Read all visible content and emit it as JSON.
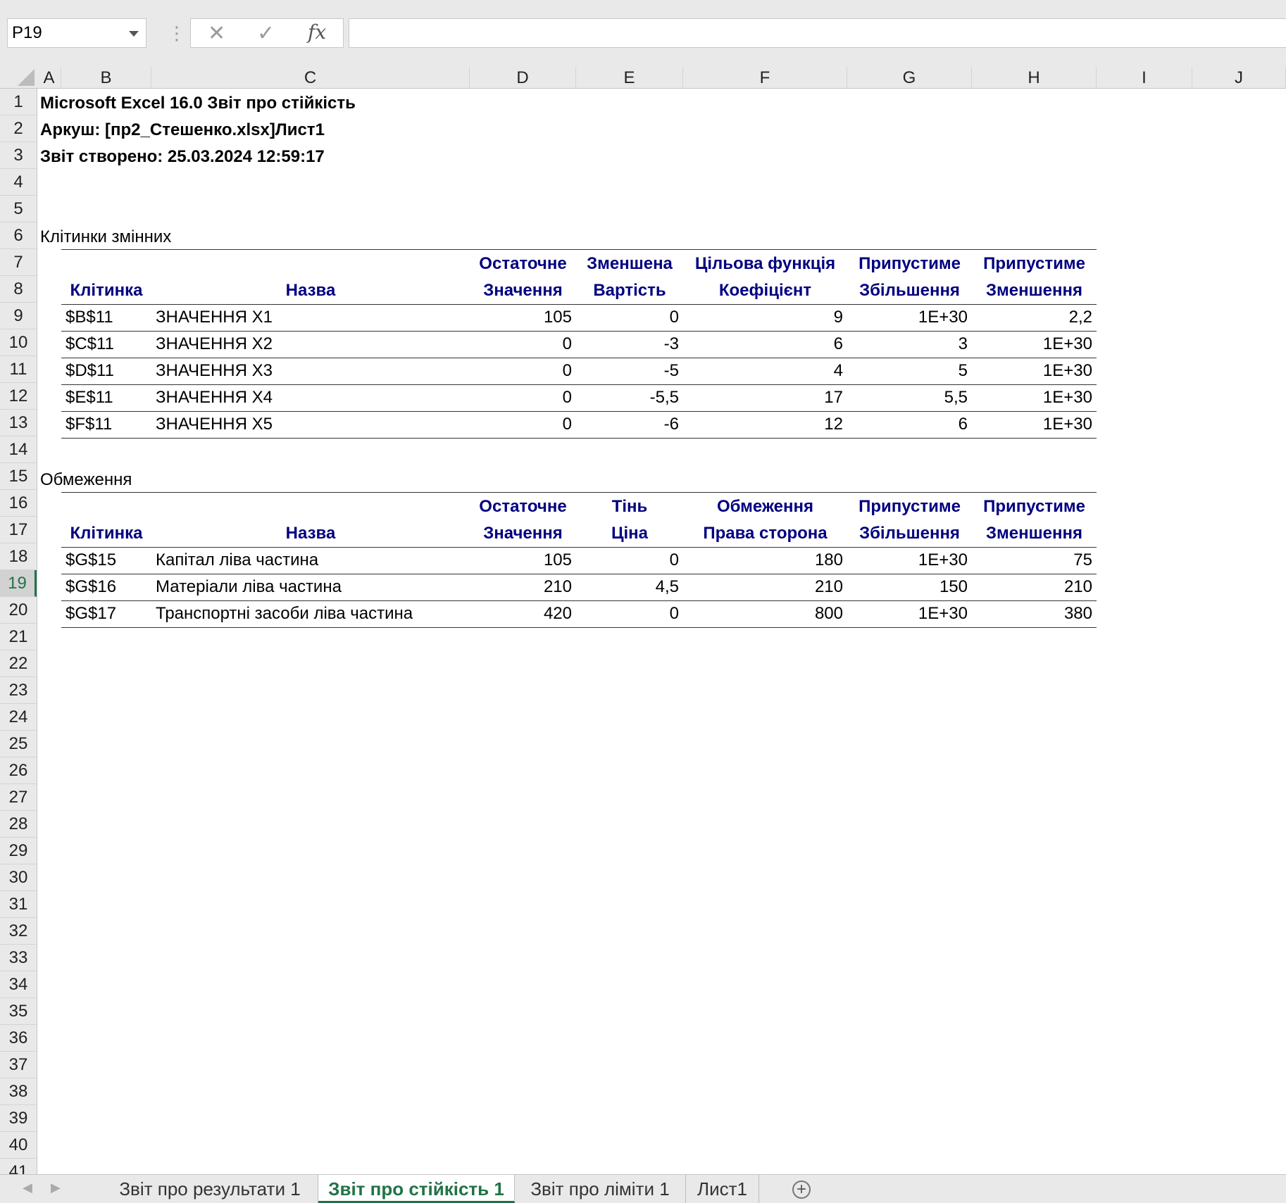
{
  "formula_bar": {
    "name_box": "P19",
    "cancel_icon": "✕",
    "enter_icon": "✓",
    "fx_label": "fx",
    "formula": ""
  },
  "columns": [
    "A",
    "B",
    "C",
    "D",
    "E",
    "F",
    "G",
    "H",
    "I",
    "J"
  ],
  "rows": [
    "1",
    "2",
    "3",
    "4",
    "5",
    "6",
    "7",
    "8",
    "9",
    "10",
    "11",
    "12",
    "13",
    "14",
    "15",
    "16",
    "17",
    "18",
    "19",
    "20",
    "21",
    "22",
    "23",
    "24",
    "25",
    "26",
    "27",
    "28",
    "29",
    "30",
    "31",
    "32",
    "33",
    "34",
    "35",
    "36",
    "37",
    "38",
    "39",
    "40",
    "41"
  ],
  "selected_row": "19",
  "report": {
    "title": "Microsoft Excel 16.0 Звіт про стійкість",
    "sheet": "Аркуш: [пр2_Стешенко.xlsx]Лист1",
    "created": "Звіт створено: 25.03.2024 12:59:17"
  },
  "variables": {
    "section_title": "Клітинки змінних",
    "headers_top": [
      "",
      "",
      "Остаточне",
      "Зменшена",
      "Цільова функція",
      "Припустиме",
      "Припустиме"
    ],
    "headers_bottom": [
      "Клітинка",
      "Назва",
      "Значення",
      "Вартість",
      "Коефіцієнт",
      "Збільшення",
      "Зменшення"
    ],
    "rows": [
      [
        "$B$11",
        "ЗНАЧЕННЯ Х1",
        "105",
        "0",
        "9",
        "1E+30",
        "2,2"
      ],
      [
        "$C$11",
        "ЗНАЧЕННЯ Х2",
        "0",
        "-3",
        "6",
        "3",
        "1E+30"
      ],
      [
        "$D$11",
        "ЗНАЧЕННЯ Х3",
        "0",
        "-5",
        "4",
        "5",
        "1E+30"
      ],
      [
        "$E$11",
        "ЗНАЧЕННЯ Х4",
        "0",
        "-5,5",
        "17",
        "5,5",
        "1E+30"
      ],
      [
        "$F$11",
        "ЗНАЧЕННЯ Х5",
        "0",
        "-6",
        "12",
        "6",
        "1E+30"
      ]
    ]
  },
  "constraints": {
    "section_title": "Обмеження",
    "headers_top": [
      "",
      "",
      "Остаточне",
      "Тінь",
      "Обмеження",
      "Припустиме",
      "Припустиме"
    ],
    "headers_bottom": [
      "Клітинка",
      "Назва",
      "Значення",
      "Ціна",
      "Права сторона",
      "Збільшення",
      "Зменшення"
    ],
    "rows": [
      [
        "$G$15",
        "Капітал ліва частина",
        "105",
        "0",
        "180",
        "1E+30",
        "75"
      ],
      [
        "$G$16",
        "Матеріали ліва частина",
        "210",
        "4,5",
        "210",
        "150",
        "210"
      ],
      [
        "$G$17",
        "Транспортні засоби  ліва частина",
        "420",
        "0",
        "800",
        "1E+30",
        "380"
      ]
    ]
  },
  "sheet_tabs": [
    "Звіт про результати 1",
    "Звіт про стійкість 1",
    "Звіт про ліміти 1",
    "Лист1"
  ],
  "active_tab": 1
}
